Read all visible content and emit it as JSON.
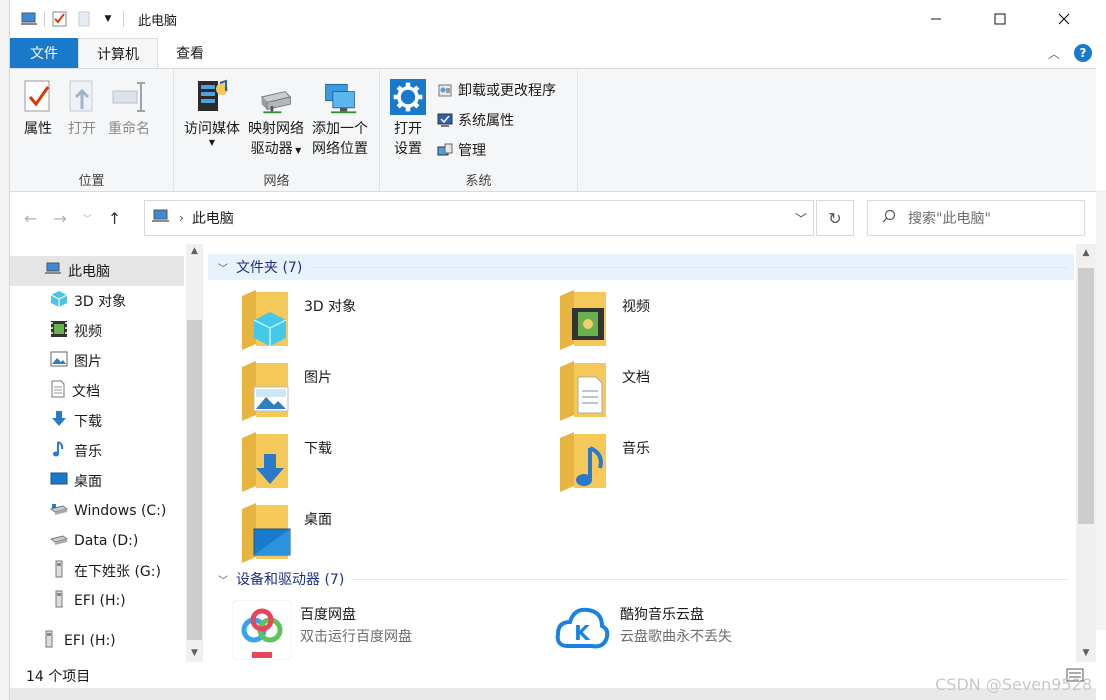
{
  "window": {
    "title": "此电脑"
  },
  "tabs": [
    {
      "label": "文件"
    },
    {
      "label": "计算机"
    },
    {
      "label": "查看"
    }
  ],
  "ribbon": {
    "location": {
      "label": "位置",
      "buttons": [
        {
          "label": "属性"
        },
        {
          "label": "打开"
        },
        {
          "label": "重命名"
        }
      ]
    },
    "network": {
      "label": "网络",
      "access_media": "访问媒体",
      "map_drive_line1": "映射网络",
      "map_drive_line2": "驱动器",
      "add_location_line1": "添加一个",
      "add_location_line2": "网络位置"
    },
    "system": {
      "label": "系统",
      "open_settings_line1": "打开",
      "open_settings_line2": "设置",
      "uninstall": "卸载或更改程序",
      "system_properties": "系统属性",
      "manage": "管理"
    }
  },
  "address": {
    "path": "此电脑",
    "search_placeholder": "搜索\"此电脑\""
  },
  "nav": {
    "items": [
      {
        "label": "此电脑",
        "icon": "pc-icon"
      },
      {
        "label": "3D 对象",
        "icon": "cube-icon"
      },
      {
        "label": "视频",
        "icon": "video-icon"
      },
      {
        "label": "图片",
        "icon": "picture-icon"
      },
      {
        "label": "文档",
        "icon": "document-icon"
      },
      {
        "label": "下载",
        "icon": "download-icon"
      },
      {
        "label": "音乐",
        "icon": "music-icon"
      },
      {
        "label": "桌面",
        "icon": "desktop-icon"
      },
      {
        "label": "Windows (C:)",
        "icon": "drive-icon"
      },
      {
        "label": "Data (D:)",
        "icon": "drive-icon"
      },
      {
        "label": "在下姓张 (G:)",
        "icon": "usb-drive-icon"
      },
      {
        "label": "EFI (H:)",
        "icon": "usb-drive-icon"
      },
      {
        "label": "EFI (H:)",
        "icon": "usb-drive-icon"
      }
    ]
  },
  "content": {
    "folders_header": "文件夹 (7)",
    "folders": [
      {
        "label": "3D 对象"
      },
      {
        "label": "视频"
      },
      {
        "label": "图片"
      },
      {
        "label": "文档"
      },
      {
        "label": "下载"
      },
      {
        "label": "音乐"
      },
      {
        "label": "桌面"
      }
    ],
    "devices_header": "设备和驱动器 (7)",
    "devices": [
      {
        "label": "百度网盘",
        "sub": "双击运行百度网盘"
      },
      {
        "label": "酷狗音乐云盘",
        "sub": "云盘歌曲永不丢失"
      }
    ]
  },
  "status": {
    "count": "14 个项目"
  },
  "watermark": "CSDN @Seven9528",
  "colors": {
    "accent": "#1979ca",
    "folder": "#f5c85a",
    "header_text": "#1e3287"
  }
}
